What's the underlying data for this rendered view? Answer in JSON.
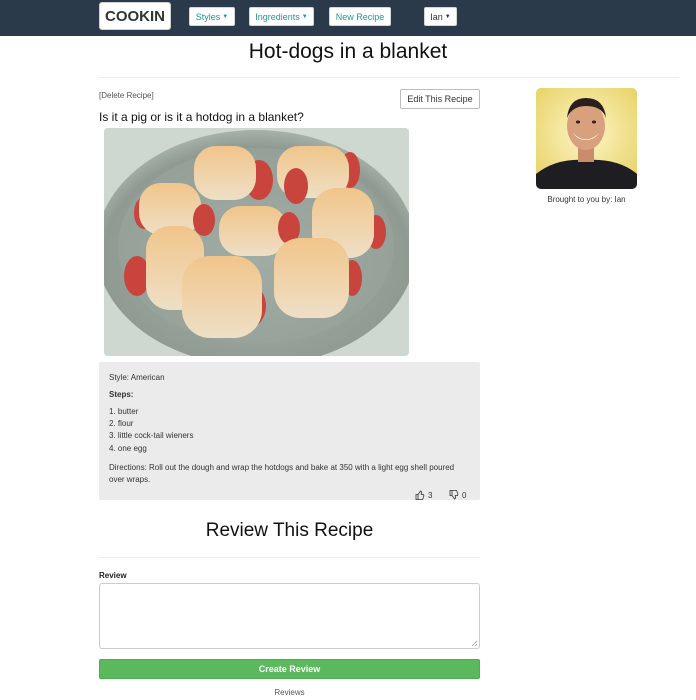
{
  "navbar": {
    "brand": "COOKIN",
    "styles": "Styles",
    "ingredients": "Ingredients",
    "new_recipe": "New Recipe",
    "user": "Ian"
  },
  "recipe": {
    "title": "Hot-dogs in a blanket",
    "delete_label": "[Delete Recipe]",
    "edit_label": "Edit This Recipe",
    "description": "Is it a pig or is it a hotdog in a blanket?",
    "style": "Style: American",
    "steps_label": "Steps:",
    "steps": [
      "1. butter",
      "2. flour",
      "3. little cock-tail wieners",
      "4. one egg"
    ],
    "directions": "Directions: Roll out the dough and wrap the hotdogs and bake at 350 with a light egg shell poured over wraps.",
    "upvotes": "3",
    "downvotes": "0"
  },
  "author": {
    "caption": "Brought to you by: Ian"
  },
  "review": {
    "title": "Review This Recipe",
    "label": "Review",
    "value": "",
    "submit_label": "Create Review",
    "reviews_heading": "Reviews"
  },
  "icons": {
    "upvote": "thumbs-up-icon",
    "downvote": "thumbs-down-icon"
  },
  "colors": {
    "navbar": "#2b3a4a",
    "accent": "#1a9b8e",
    "submit": "#5cb85c"
  }
}
